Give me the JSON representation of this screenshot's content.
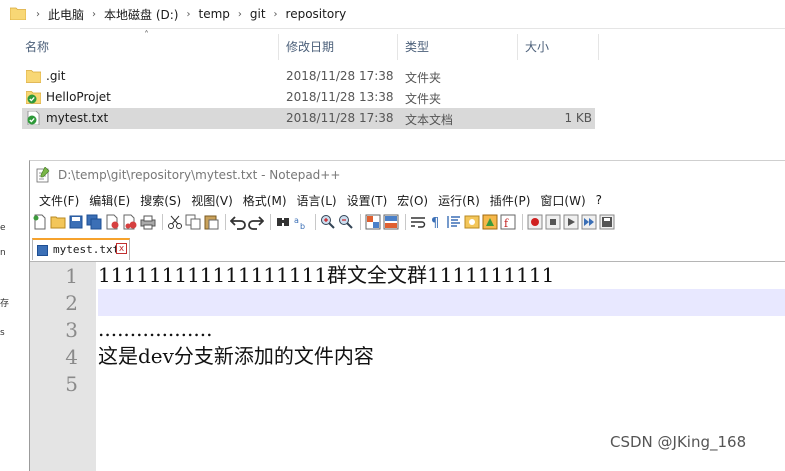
{
  "explorer": {
    "breadcrumb": [
      "此电脑",
      "本地磁盘 (D:)",
      "temp",
      "git",
      "repository"
    ],
    "columns": {
      "name": "名称",
      "date": "修改日期",
      "type": "类型",
      "size": "大小"
    },
    "files": [
      {
        "name": ".git",
        "date": "2018/11/28 17:38",
        "type": "文件夹",
        "size": "",
        "icon": "folder-icon"
      },
      {
        "name": "HelloProjet",
        "date": "2018/11/28 13:38",
        "type": "文件夹",
        "size": "",
        "icon": "git-folder-icon"
      },
      {
        "name": "mytest.txt",
        "date": "2018/11/28 17:38",
        "type": "文本文档",
        "size": "1 KB",
        "icon": "git-file-icon"
      }
    ],
    "left_edge_glyphs": [
      "e",
      "n",
      "存",
      "s"
    ]
  },
  "notepad": {
    "title": "D:\\temp\\git\\repository\\mytest.txt - Notepad++",
    "menu": [
      "文件(F)",
      "编辑(E)",
      "搜索(S)",
      "视图(V)",
      "格式(M)",
      "语言(L)",
      "设置(T)",
      "宏(O)",
      "运行(R)",
      "插件(P)",
      "窗口(W)",
      "?"
    ],
    "tab": {
      "name": "mytest.txt",
      "close": "x"
    },
    "line_numbers": [
      "1",
      "2",
      "3",
      "4",
      "5"
    ],
    "lines": [
      "111111111111111111群文全文群1111111111",
      "",
      "..................",
      "这是dev分支新添加的文件内容",
      ""
    ],
    "current_line": 2
  },
  "watermark": "CSDN @JKing_168",
  "colors": {
    "selection": "#d9d9d9",
    "current_line": "#e8e8ff",
    "gutter": "#e4e4e4",
    "tab_accent": "#f6a22c"
  }
}
